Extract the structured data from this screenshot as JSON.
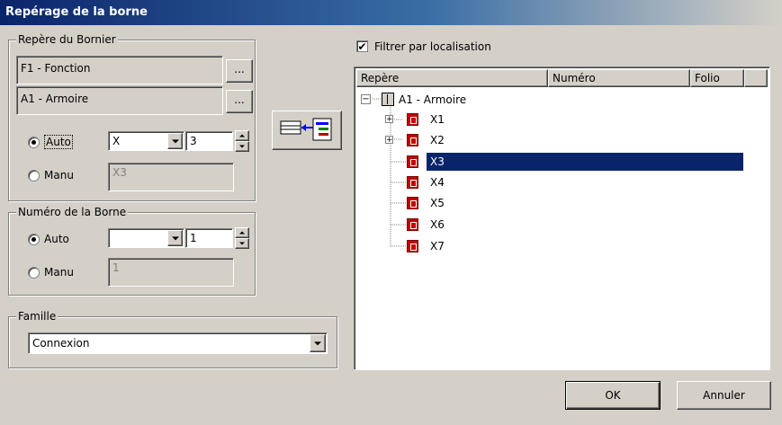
{
  "window": {
    "title": "Repérage de la borne"
  },
  "bornier": {
    "legend": "Repère du Bornier",
    "fonction_value": "F1 - Fonction",
    "armoire_value": "A1 - Armoire",
    "browse_label": "...",
    "auto_label": "Auto",
    "manu_label": "Manu",
    "auto_selected": true,
    "prefix_value": "X",
    "number_value": "3",
    "manu_value": "X3"
  },
  "borne": {
    "legend": "Numéro de la Borne",
    "auto_label": "Auto",
    "manu_label": "Manu",
    "auto_selected": true,
    "prefix_value": "",
    "number_value": "1",
    "manu_value": "1"
  },
  "famille": {
    "legend": "Famille",
    "selected": "Connexion"
  },
  "filter": {
    "label": "Filtrer par localisation",
    "checked": true
  },
  "tree": {
    "columns": [
      "Repère",
      "Numéro",
      "Folio"
    ],
    "root": "A1 - Armoire",
    "items": [
      {
        "label": "X1",
        "expandable": true,
        "selected": false
      },
      {
        "label": "X2",
        "expandable": true,
        "selected": false
      },
      {
        "label": "X3",
        "expandable": false,
        "selected": true
      },
      {
        "label": "X4",
        "expandable": false,
        "selected": false
      },
      {
        "label": "X5",
        "expandable": false,
        "selected": false
      },
      {
        "label": "X6",
        "expandable": false,
        "selected": false
      },
      {
        "label": "X7",
        "expandable": false,
        "selected": false
      }
    ]
  },
  "buttons": {
    "ok": "OK",
    "cancel": "Annuler"
  },
  "colors": {
    "selection": "#0a246a",
    "title_start": "#0a246a",
    "face": "#d4d0c8"
  }
}
